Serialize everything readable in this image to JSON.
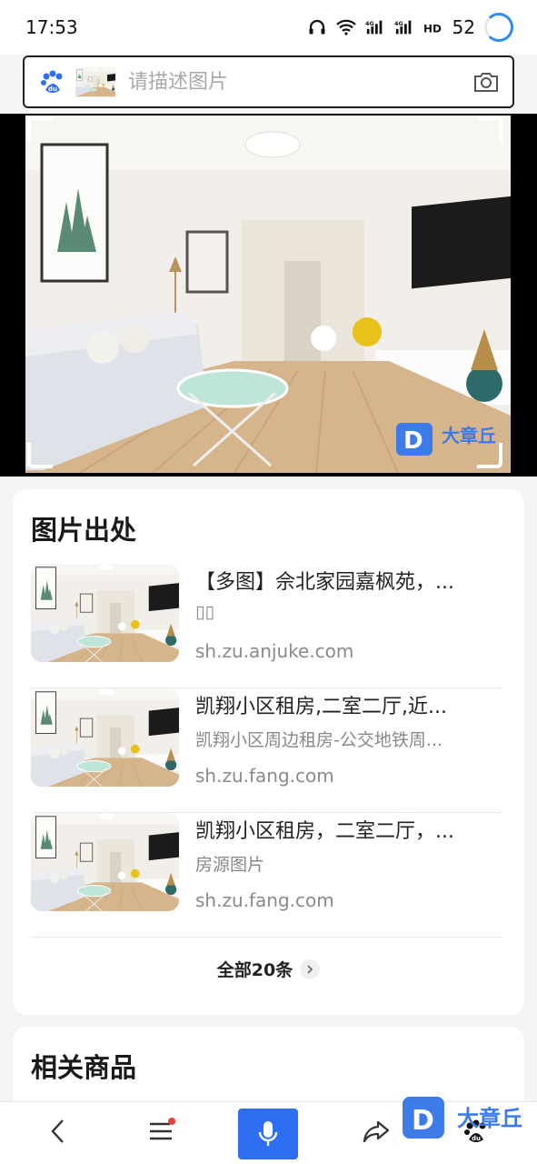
{
  "status_bar": {
    "time": "17:53",
    "battery": "52",
    "icons": [
      "headphones-icon",
      "wifi-icon",
      "signal-4g-icon",
      "signal-4g-icon",
      "hd-icon"
    ]
  },
  "search": {
    "placeholder": "请描述图片",
    "icons": [
      "baidu-paw-icon",
      "camera-icon"
    ]
  },
  "viewer": {
    "watermark_text": "大章丘"
  },
  "source_section": {
    "heading": "图片出处",
    "items": [
      {
        "title": "【多图】佘北家园嘉枫苑，...",
        "subtitle": "▯▯",
        "url": "sh.zu.anjuke.com"
      },
      {
        "title": "凯翔小区租房,二室二厅,近...",
        "subtitle": "凯翔小区周边租房-公交地铁周...",
        "url": "sh.zu.fang.com"
      },
      {
        "title": "凯翔小区租房，二室二厅，...",
        "subtitle": "房源图片",
        "url": "sh.zu.fang.com"
      }
    ],
    "more_label": "全部20条"
  },
  "goods_section": {
    "heading": "相关商品"
  },
  "bottom_bar": {
    "icons": [
      "back-icon",
      "menu-icon",
      "microphone-icon",
      "share-icon",
      "baidu-paw-icon"
    ],
    "watermark_text": "大章丘"
  },
  "colors": {
    "accent_blue": "#2e6ff2",
    "notification_red": "#f03e3e"
  }
}
